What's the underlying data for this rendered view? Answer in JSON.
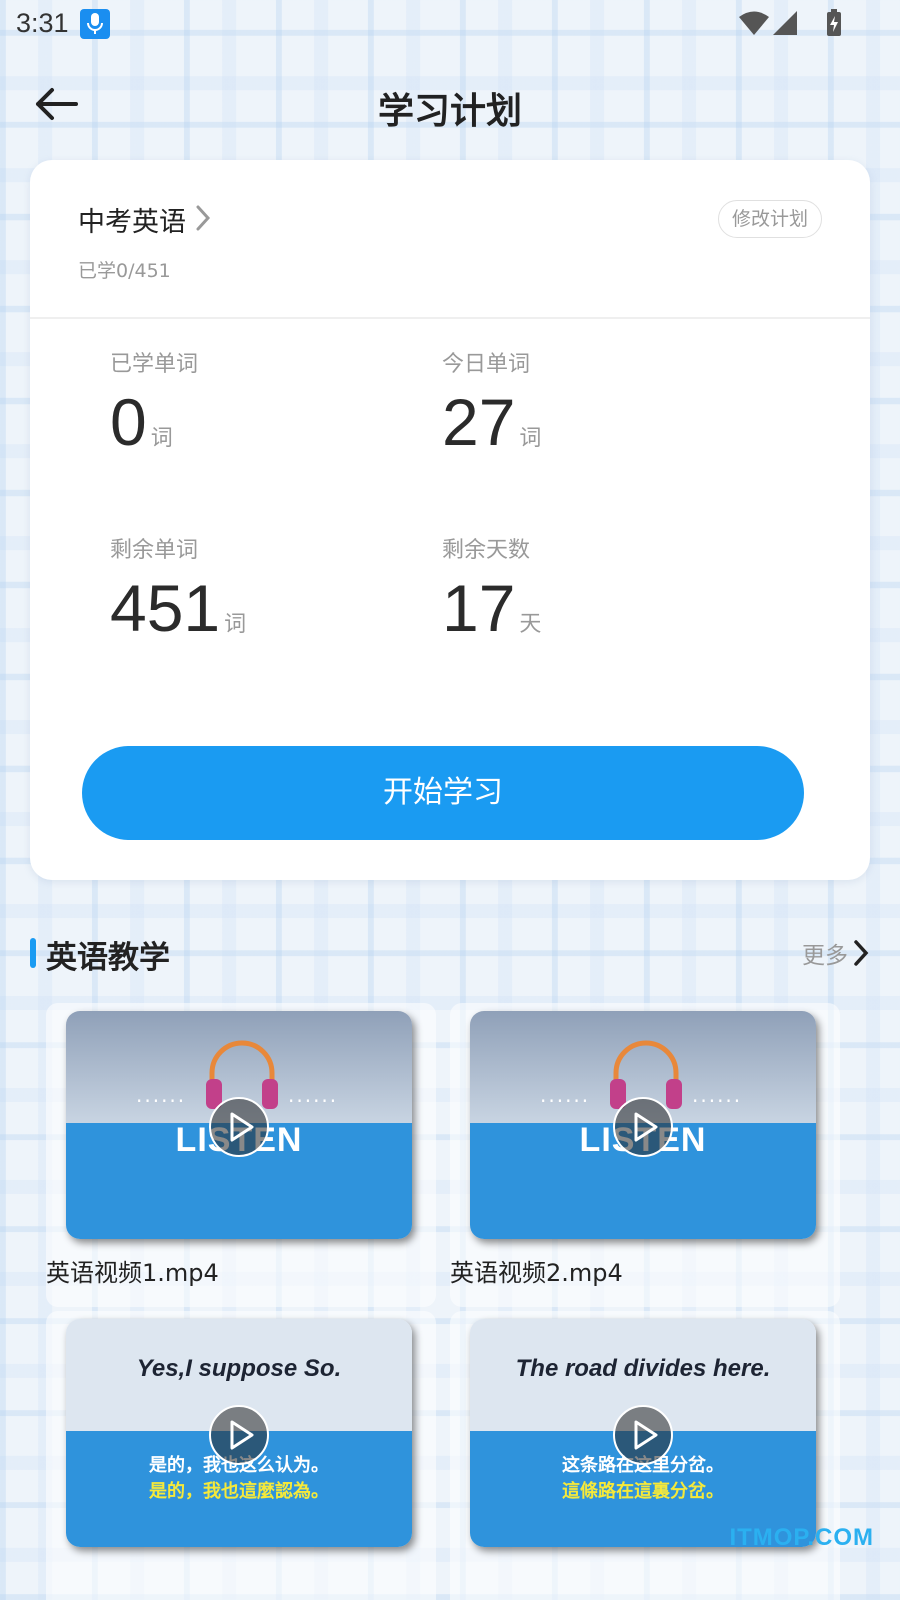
{
  "status_bar": {
    "time": "3:31"
  },
  "header": {
    "title": "学习计划",
    "back_icon": "back-arrow-icon"
  },
  "plan": {
    "course": "中考英语",
    "progress": "已学0/451",
    "edit_label": "修改计划",
    "stats": [
      {
        "label": "已学单词",
        "value": "0",
        "unit": "词"
      },
      {
        "label": "今日单词",
        "value": "27",
        "unit": "词"
      },
      {
        "label": "剩余单词",
        "value": "451",
        "unit": "词"
      },
      {
        "label": "剩余天数",
        "value": "17",
        "unit": "天"
      }
    ],
    "start_label": "开始学习"
  },
  "section": {
    "title": "英语教学",
    "more_label": "更多"
  },
  "videos": [
    {
      "title": "英语视频1.mp4",
      "thumb_text": "LISTEN",
      "dots": "······"
    },
    {
      "title": "英语视频2.mp4",
      "thumb_text": "LISTEN",
      "dots": "······"
    },
    {
      "title": "",
      "phrase_en": "Yes,I suppose So.",
      "phrase_zh1": "是的，我也这么认为。",
      "phrase_zh2": "是的，我也這麼認為。"
    },
    {
      "title": "",
      "phrase_en": "The road divides here.",
      "phrase_zh1": "这条路在这里分岔。",
      "phrase_zh2": "這條路在這裏分岔。"
    }
  ],
  "watermark": "ITMOP.COM",
  "colors": {
    "accent": "#1a9bf2",
    "watermark": "#2bb0f0"
  }
}
